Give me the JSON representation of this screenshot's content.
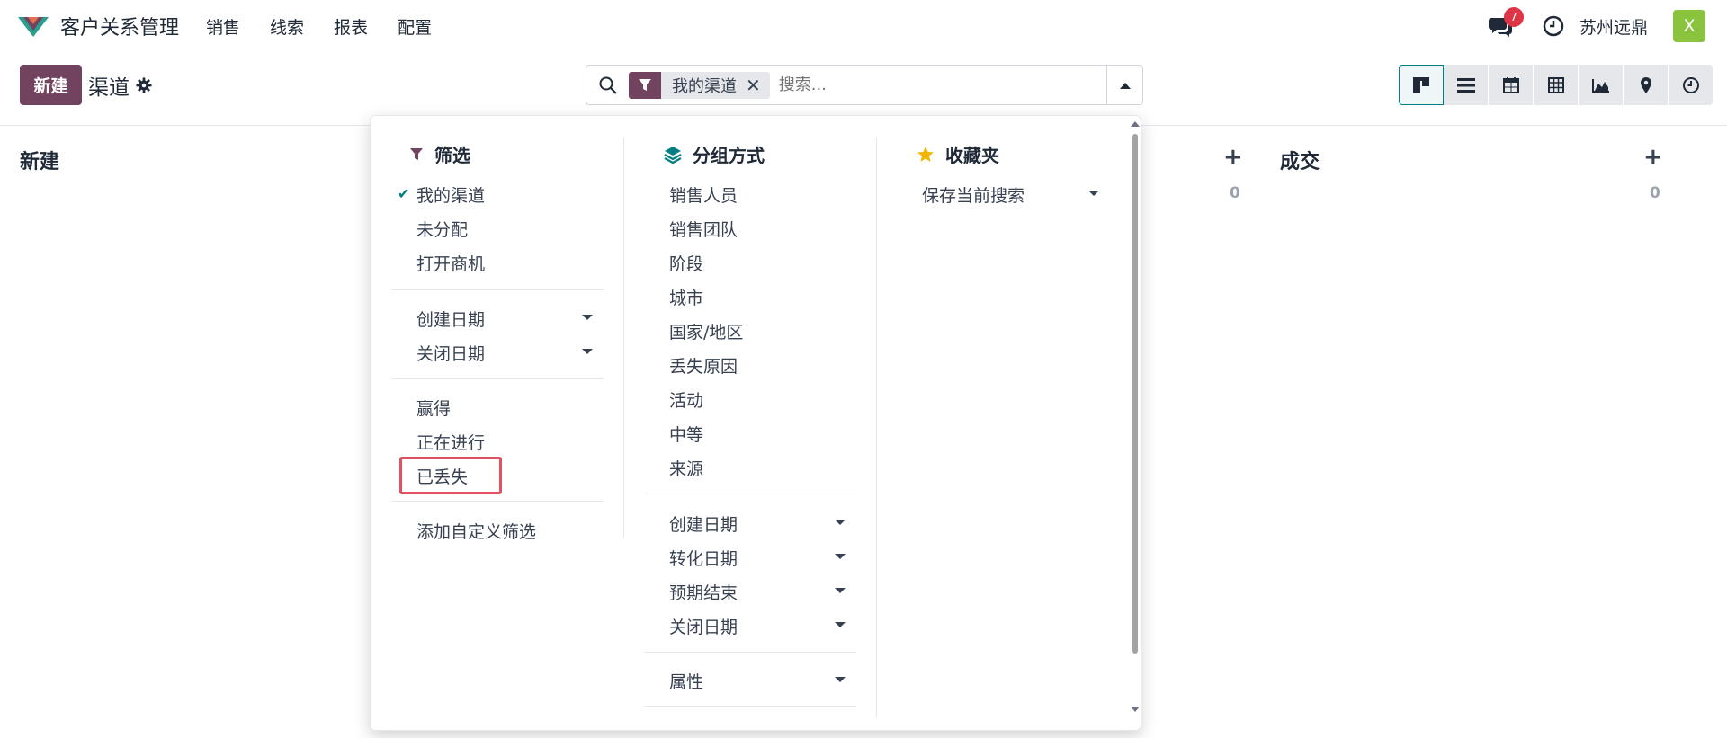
{
  "navbar": {
    "app_title": "客户关系管理",
    "menu": [
      "销售",
      "线索",
      "报表",
      "配置"
    ],
    "chat_count": "7",
    "company": "苏州远鼎",
    "avatar_letter": "X"
  },
  "control_panel": {
    "new_label": "新建",
    "breadcrumb": "渠道",
    "search": {
      "facet_label": "我的渠道",
      "facet_close": "✕",
      "placeholder": "搜索..."
    }
  },
  "kanban": {
    "columns": [
      {
        "title": "新建"
      },
      {
        "plus": "+",
        "count": "0"
      },
      {
        "title": "成交",
        "plus": "+",
        "count": "0"
      }
    ]
  },
  "dropdown": {
    "filters": {
      "heading": "筛选",
      "group1": [
        "我的渠道",
        "未分配",
        "打开商机"
      ],
      "group2": [
        "创建日期",
        "关闭日期"
      ],
      "group3": [
        "赢得",
        "正在进行",
        "已丢失"
      ],
      "custom": "添加自定义筛选"
    },
    "group_by": {
      "heading": "分组方式",
      "options": [
        "销售人员",
        "销售团队",
        "阶段",
        "城市",
        "国家/地区",
        "丢失原因",
        "活动",
        "中等",
        "来源"
      ],
      "date_options": [
        "创建日期",
        "转化日期",
        "预期结束",
        "关闭日期"
      ],
      "properties": "属性"
    },
    "favorites": {
      "heading": "收藏夹",
      "save_current": "保存当前搜索"
    }
  },
  "colors": {
    "primary": "#71435f",
    "accent": "#017e84",
    "highlight": "#e05260",
    "badge": "#dc3545",
    "avatar": "#8ac43f"
  }
}
